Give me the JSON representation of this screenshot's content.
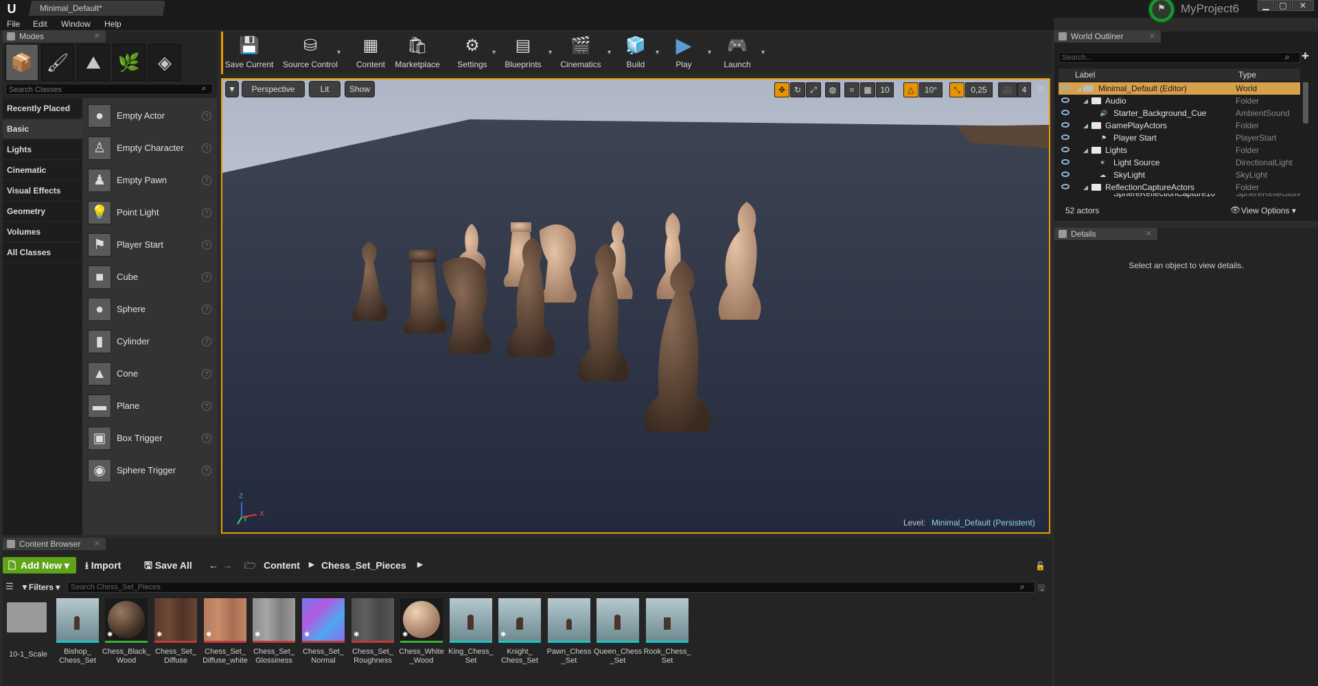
{
  "window": {
    "doc_tab": "Minimal_Default*",
    "project_name": "MyProject6",
    "controls": {
      "minimize": "▁",
      "maximize": "▢",
      "close": "✕"
    }
  },
  "menubar": {
    "items": [
      "File",
      "Edit",
      "Window",
      "Help"
    ]
  },
  "modes": {
    "tab_label": "Modes",
    "mode_icons": [
      "place-mode-icon",
      "paint-mode-icon",
      "landscape-mode-icon",
      "foliage-mode-icon",
      "geometry-mode-icon"
    ],
    "search_placeholder": "Search Classes",
    "categories": [
      "Recently Placed",
      "Basic",
      "Lights",
      "Cinematic",
      "Visual Effects",
      "Geometry",
      "Volumes",
      "All Classes"
    ],
    "selected_category": "Basic",
    "classes": [
      "Empty Actor",
      "Empty Character",
      "Empty Pawn",
      "Point Light",
      "Player Start",
      "Cube",
      "Sphere",
      "Cylinder",
      "Cone",
      "Plane",
      "Box Trigger",
      "Sphere Trigger"
    ]
  },
  "toolbar": {
    "buttons": [
      "Save Current",
      "Source Control",
      "Content",
      "Marketplace",
      "Settings",
      "Blueprints",
      "Cinematics",
      "Build",
      "Play",
      "Launch"
    ]
  },
  "viewport": {
    "perspective": "Perspective",
    "lit": "Lit",
    "show": "Show",
    "grid_snap": "10",
    "rotation_snap": "10°",
    "scale_snap": "0,25",
    "camera_speed": "4",
    "level_label": "Level:",
    "level_value": "Minimal_Default (Persistent)",
    "axis": {
      "x": "X",
      "y": "Y",
      "z": "Z"
    },
    "accent": "#e8a000"
  },
  "outliner": {
    "tab_label": "World Outliner",
    "search_placeholder": "Search...",
    "col_label": "Label",
    "col_type": "Type",
    "rows": [
      {
        "label": "Minimal_Default (Editor)",
        "type": "World"
      },
      {
        "label": "Audio",
        "type": "Folder"
      },
      {
        "label": "Starter_Background_Cue",
        "type": "AmbientSound"
      },
      {
        "label": "GamePlayActors",
        "type": "Folder"
      },
      {
        "label": "Player Start",
        "type": "PlayerStart"
      },
      {
        "label": "Lights",
        "type": "Folder"
      },
      {
        "label": "Light Source",
        "type": "DirectionalLight"
      },
      {
        "label": "SkyLight",
        "type": "SkyLight"
      },
      {
        "label": "ReflectionCaptureActors",
        "type": "Folder"
      },
      {
        "label": "SphereReflectionCapture10",
        "type": "SphereReflectionC"
      }
    ],
    "actor_count": "52 actors",
    "view_options": "View Options"
  },
  "details": {
    "tab_label": "Details",
    "message": "Select an object to view details."
  },
  "content_browser": {
    "tab_label": "Content Browser",
    "add_new": "Add New",
    "import": "Import",
    "save_all": "Save All",
    "path": [
      "Content",
      "Chess_Set_Pieces"
    ],
    "filters": "Filters",
    "search_placeholder": "Search Chess_Set_Pieces",
    "assets": [
      {
        "name": "10-1_Scale",
        "kind": "folder"
      },
      {
        "name": "Bishop_ Chess_Set",
        "kind": "mesh"
      },
      {
        "name": "Chess_Black_ Wood",
        "kind": "material-dark"
      },
      {
        "name": "Chess_Set_ Diffuse",
        "kind": "texture-wood-dark"
      },
      {
        "name": "Chess_Set_ Diffuse_white",
        "kind": "texture-wood-light"
      },
      {
        "name": "Chess_Set_ Glossiness",
        "kind": "texture-gray"
      },
      {
        "name": "Chess_Set_ Normal",
        "kind": "texture-normal"
      },
      {
        "name": "Chess_Set_ Roughness",
        "kind": "texture-dark-gray"
      },
      {
        "name": "Chess_White _Wood",
        "kind": "material-light"
      },
      {
        "name": "King_Chess_ Set",
        "kind": "mesh"
      },
      {
        "name": "Knight_ Chess_Set",
        "kind": "mesh"
      },
      {
        "name": "Pawn_Chess _Set",
        "kind": "mesh"
      },
      {
        "name": "Queen_Chess _Set",
        "kind": "mesh"
      },
      {
        "name": "Rook_Chess_ Set",
        "kind": "mesh"
      }
    ]
  },
  "colors": {
    "green": "#5ea318",
    "selection": "#d7a04b",
    "link": "#8fd4e8"
  }
}
